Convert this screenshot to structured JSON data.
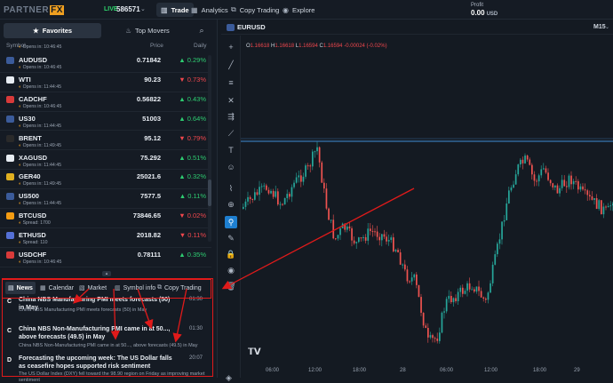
{
  "brand": {
    "name_part1": "PARTNER",
    "name_part2": "FX",
    "accent": "#f0a020"
  },
  "account": {
    "mode": "LIVE",
    "id": "586571"
  },
  "nav": {
    "tabs": [
      {
        "label": "Trade",
        "icon": "chart-icon"
      },
      {
        "label": "Analytics",
        "icon": "analytics-icon"
      },
      {
        "label": "Copy Trading",
        "icon": "copy-trading-icon"
      },
      {
        "label": "Explore",
        "icon": "explore-icon"
      }
    ]
  },
  "profit": {
    "label": "Profit",
    "value": "0.00",
    "currency": "USD"
  },
  "watchlist": {
    "tabs": [
      "Favorites",
      "Top Movers"
    ],
    "columns": {
      "symbol": "Symbol",
      "price": "Price",
      "daily": "Daily"
    },
    "partial_top": "Opens in: 10:46:45",
    "rows": [
      {
        "symbol": "AUDUSD",
        "sub": "Opens in: 10:46:45",
        "price": "0.71842",
        "daily": "0.29%",
        "dir": "up",
        "flag": "#3b5b9a"
      },
      {
        "symbol": "WTI",
        "sub": "Opens in: 11:44:45",
        "price": "90.23",
        "daily": "0.73%",
        "dir": "dn",
        "flag": "#e8edf3"
      },
      {
        "symbol": "CADCHF",
        "sub": "Opens in: 10:46:45",
        "price": "0.56822",
        "daily": "0.43%",
        "dir": "up",
        "flag": "#d83a3a"
      },
      {
        "symbol": "US30",
        "sub": "Opens in: 11:44:45",
        "price": "51003",
        "daily": "0.64%",
        "dir": "up",
        "flag": "#3b5b9a"
      },
      {
        "symbol": "BRENT",
        "sub": "Opens in: 11:49:45",
        "price": "95.12",
        "daily": "0.79%",
        "dir": "dn",
        "flag": "#2a2a2a"
      },
      {
        "symbol": "XAGUSD",
        "sub": "Opens in: 11:44:45",
        "price": "75.292",
        "daily": "0.51%",
        "dir": "up",
        "flag": "#e8edf3"
      },
      {
        "symbol": "GER40",
        "sub": "Opens in: 11:49:45",
        "price": "25021.6",
        "daily": "0.32%",
        "dir": "up",
        "flag": "#e0b020"
      },
      {
        "symbol": "US500",
        "sub": "Opens in: 11:44:45",
        "price": "7577.5",
        "daily": "0.11%",
        "dir": "up",
        "flag": "#3b5b9a"
      },
      {
        "symbol": "BTCUSD",
        "sub": "Spread: 1700",
        "price": "73846.65",
        "daily": "0.02%",
        "dir": "dn",
        "flag": "#f39c12"
      },
      {
        "symbol": "ETHUSD",
        "sub": "Spread: 110",
        "price": "2018.82",
        "daily": "0.11%",
        "dir": "dn",
        "flag": "#5470d6"
      },
      {
        "symbol": "USDCHF",
        "sub": "Opens in: 10:46:45",
        "price": "0.78111",
        "daily": "0.35%",
        "dir": "up",
        "flag": "#d83a3a"
      }
    ]
  },
  "news_tabs": [
    "News",
    "Calendar",
    "Market",
    "Symbol info",
    "Copy Trading"
  ],
  "news": [
    {
      "badge": "C",
      "title": "China NBS Manufacturing PMI meets forecasts (50) in May",
      "time": "01:30",
      "body": "China NBS Manufacturing PMI meets forecasts (50) in May"
    },
    {
      "badge": "C",
      "title": "China NBS Non-Manufacturing PMI came in at 50..., above forecasts (49.5) in May",
      "time": "01:30",
      "body": "China NBS Non-Manufacturing PMI came in at 50..., above forecasts (49.5) in May"
    },
    {
      "badge": "D",
      "title": "Forecasting the upcoming week: The US Dollar falls as ceasefire hopes supported risk sentiment",
      "time": "20:07",
      "body": "The US Dollar Index (DXY) fell toward the 98.90 region on Friday as improving market sentiment"
    }
  ],
  "chart": {
    "symbol": "EURUSD",
    "timeframe": "M15",
    "ohlc": {
      "o": "1.16618",
      "h": "1.16618",
      "l": "1.16594",
      "c": "1.16594",
      "chg": "-0.00024 (-0.02%)"
    },
    "xticks": [
      "06:00",
      "12:00",
      "18:00",
      "28",
      "06:00",
      "12:00",
      "18:00",
      "29"
    ],
    "up_color": "#26a69a",
    "down_color": "#ef5350"
  },
  "tools": [
    "crosshair-icon",
    "trend-line-icon",
    "fib-icon",
    "pattern-icon",
    "measure-icon",
    "brush-icon",
    "text-icon",
    "emoji-icon",
    "ruler-icon",
    "zoom-icon",
    "magnet-icon",
    "lock-draw-icon",
    "lock-icon",
    "eye-icon",
    "trash-icon"
  ]
}
